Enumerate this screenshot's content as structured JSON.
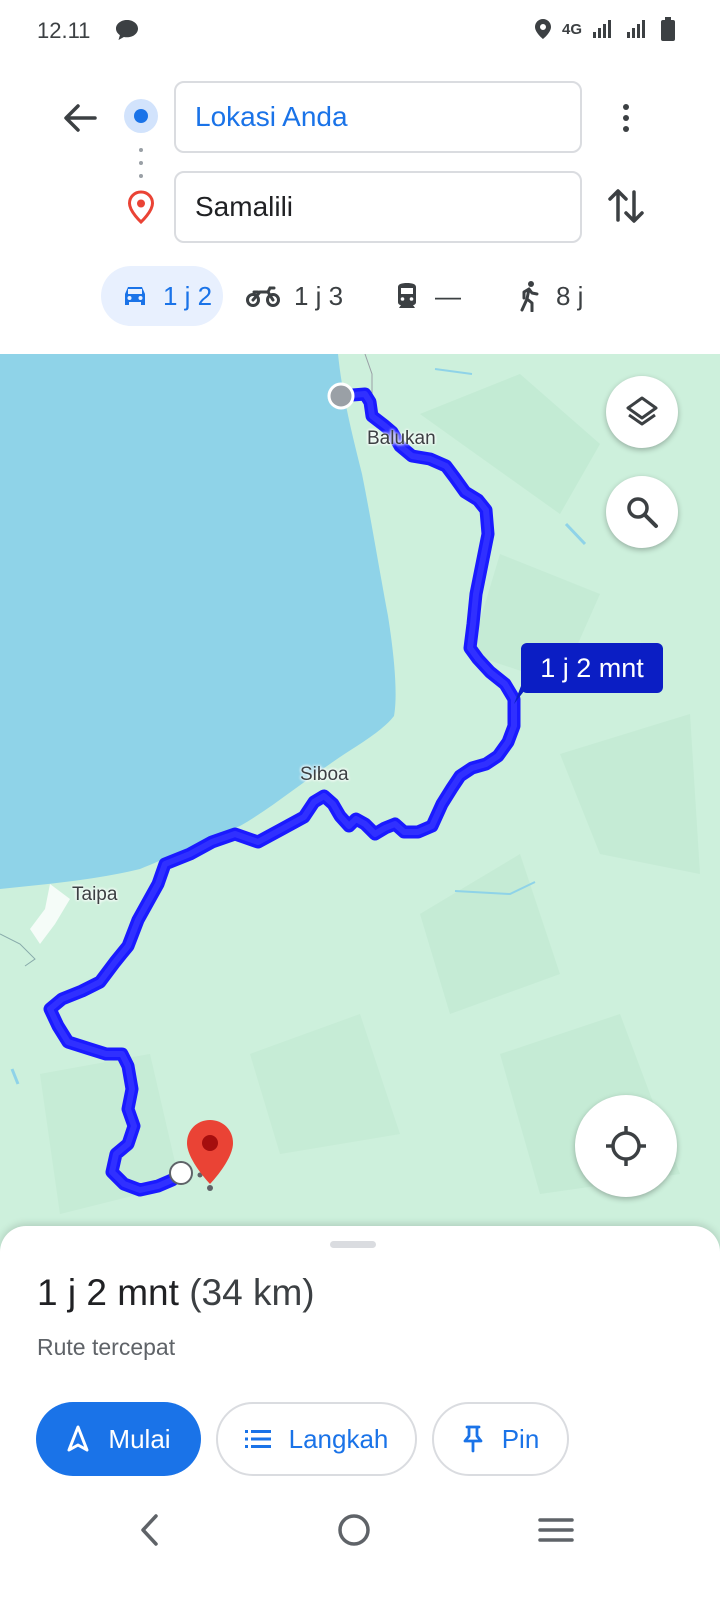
{
  "status_bar": {
    "time": "12.11",
    "network": "4G"
  },
  "directions": {
    "origin": "Lokasi Anda",
    "destination": "Samalili"
  },
  "modes": {
    "car": "1 j 2",
    "motorcycle": "1 j 3",
    "transit": "—",
    "walk": "8 j"
  },
  "map": {
    "places": {
      "balukan": "Balukan",
      "siboa": "Siboa",
      "taipa": "Taipa"
    },
    "route_duration": "1 j 2 mnt",
    "route_color": "#1a1aff",
    "water_color": "#8fd3e8",
    "land_color": "#cdf0dc"
  },
  "sheet": {
    "duration": "1 j 2 mnt",
    "distance": "(34 km)",
    "subtitle": "Rute tercepat",
    "start_label": "Mulai",
    "steps_label": "Langkah",
    "pin_label": "Pin"
  },
  "colors": {
    "accent": "#1a73e8",
    "destination_pin": "#ea4335"
  }
}
